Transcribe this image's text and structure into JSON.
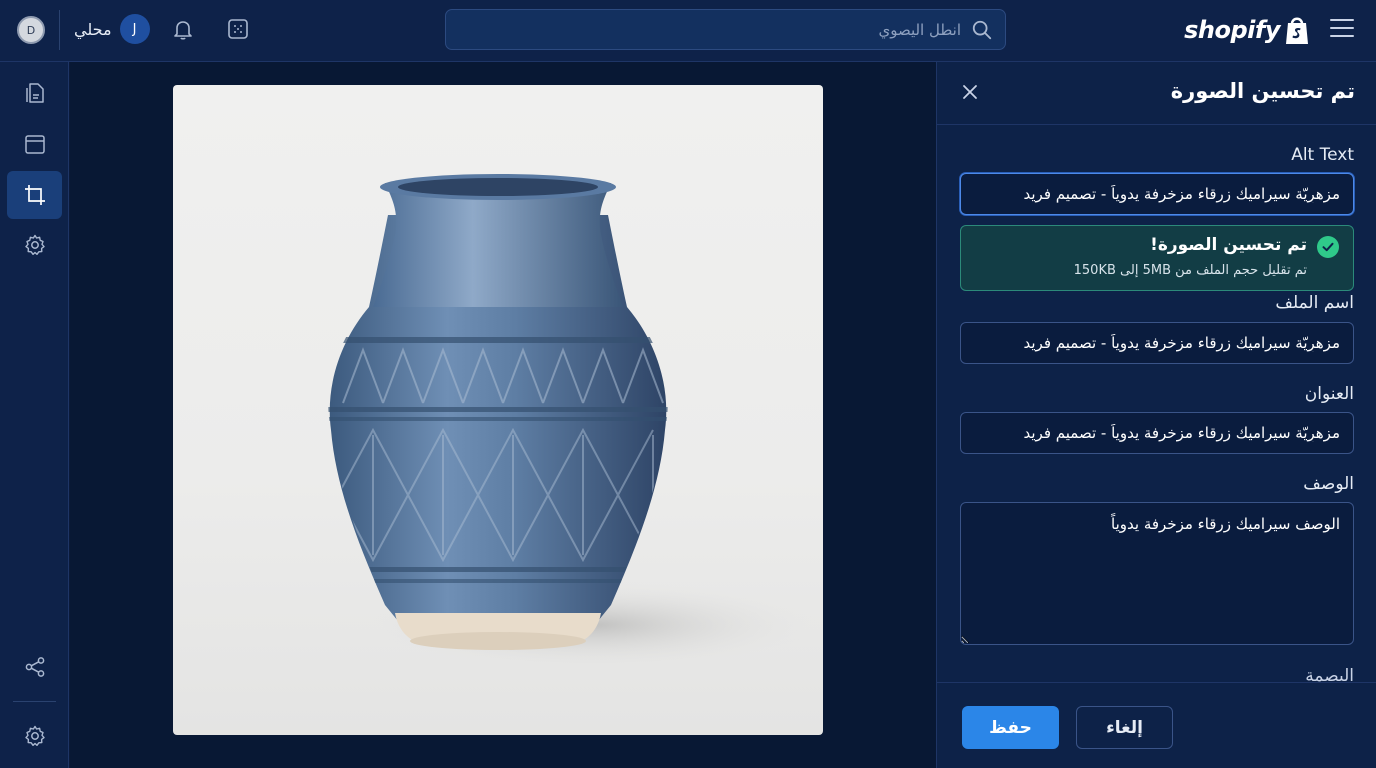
{
  "header": {
    "brand_name": "shopify",
    "search_placeholder": "انطل اليصوي",
    "store_name": "محلي",
    "store_initial": "J",
    "user_initial": "D"
  },
  "panel": {
    "title": "تم تحسين الصورة",
    "alt_text_label": "Alt Text",
    "alt_text_value": "مزهرِيّة سيراميك زرقاء مزخرفة يدوياً - تصميم فريد",
    "success_title": "تم تحسين الصورة!",
    "success_message": "تم تقليل حجم الملف من 5MB إلى 150KB",
    "filename_label": "اسم الملف",
    "filename_value": "مزهرِيّة سيراميك زرقاء مزخرفة يدوياً - تصميم فريد",
    "title_label": "العنوان",
    "title_value": "مزهرِيّة سيراميك زرقاء مزخرفة يدوياً - تصميم فريد",
    "description_label": "الوصف",
    "description_value": "الوصف سيراميك زرقاء مزخرفة يدوياً",
    "next_label": "البصمة",
    "save_label": "حفظ",
    "cancel_label": "إلغاء"
  },
  "colors": {
    "background": "#0b1a3a",
    "accent": "#2b86e8",
    "success": "#2fc98a"
  },
  "icons": [
    "menu-icon",
    "shopify-bag-icon",
    "search-icon",
    "grid-icon",
    "bell-icon",
    "file-icon",
    "archive-icon",
    "crop-icon",
    "settings-icon",
    "share-icon",
    "close-icon",
    "check-icon"
  ]
}
